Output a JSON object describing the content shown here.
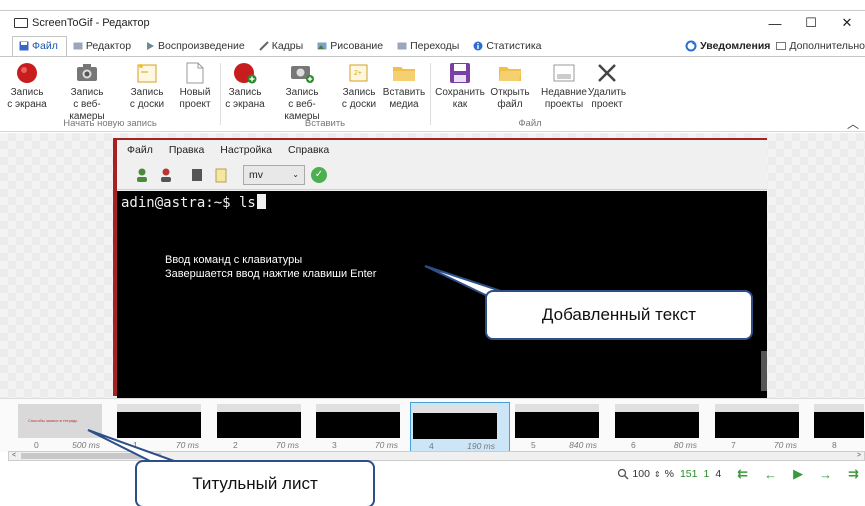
{
  "window": {
    "title": "ScreenToGif - Редактор",
    "minimize": "—",
    "maximize": "☐",
    "close": "✕"
  },
  "tabs": [
    {
      "label": "Файл",
      "active": true
    },
    {
      "label": "Редактор"
    },
    {
      "label": "Воспроизведение"
    },
    {
      "label": "Кадры"
    },
    {
      "label": "Рисование"
    },
    {
      "label": "Переходы"
    },
    {
      "label": "Статистика"
    }
  ],
  "tabs_right": {
    "notifications": "Уведомления",
    "more": "Дополнительно"
  },
  "ribbon": {
    "new_recording": {
      "group_label": "Начать новую запись",
      "buttons": [
        {
          "label1": "Запись",
          "label2": "с экрана"
        },
        {
          "label1": "Запись",
          "label2": "с веб-камеры"
        },
        {
          "label1": "Запись",
          "label2": "с доски"
        },
        {
          "label1": "Новый",
          "label2": "проект"
        }
      ]
    },
    "insert": {
      "group_label": "Вставить",
      "buttons": [
        {
          "label1": "Запись",
          "label2": "с экрана"
        },
        {
          "label1": "Запись",
          "label2": "с веб-камеры"
        },
        {
          "label1": "Запись",
          "label2": "с доски"
        },
        {
          "label1": "Вставить",
          "label2": "медиа"
        }
      ]
    },
    "file": {
      "group_label": "Файл",
      "buttons": [
        {
          "label1": "Сохранить",
          "label2": "как"
        },
        {
          "label1": "Открыть",
          "label2": "файл"
        },
        {
          "label1": "Недавние",
          "label2": "проекты"
        },
        {
          "label1": "Удалить",
          "label2": "проект"
        }
      ]
    }
  },
  "frame": {
    "menu": [
      "Файл",
      "Правка",
      "Настройка",
      "Справка"
    ],
    "combo_value": "mv",
    "prompt": "adin@astra:~$ ls",
    "overlay_line1": "Ввод команд с клавиатуры",
    "overlay_line2": "Завершается ввод нажтие клавиши Enter"
  },
  "callouts": {
    "added_text": "Добавленный текст",
    "title_sheet": "Титульный лист"
  },
  "timeline": {
    "frames": [
      {
        "index": "0",
        "duration": "500 ms",
        "title": true
      },
      {
        "index": "1",
        "duration": "70 ms"
      },
      {
        "index": "2",
        "duration": "70 ms"
      },
      {
        "index": "3",
        "duration": "70 ms"
      },
      {
        "index": "4",
        "duration": "190 ms",
        "selected": true
      },
      {
        "index": "5",
        "duration": "840 ms"
      },
      {
        "index": "6",
        "duration": "80 ms"
      },
      {
        "index": "7",
        "duration": "70 ms"
      },
      {
        "index": "8",
        "duration": ""
      }
    ],
    "title_mini_text": "Способы записи в тетрадь"
  },
  "statusbar": {
    "zoom": "100",
    "zoom_unit": "%",
    "total_frames": "151",
    "selected": "1",
    "current": "4"
  },
  "colors": {
    "accent": "#1a56b0",
    "frame_border": "#a52222",
    "callout_border": "#2d4f87",
    "nav_green": "#3a9a3a"
  }
}
